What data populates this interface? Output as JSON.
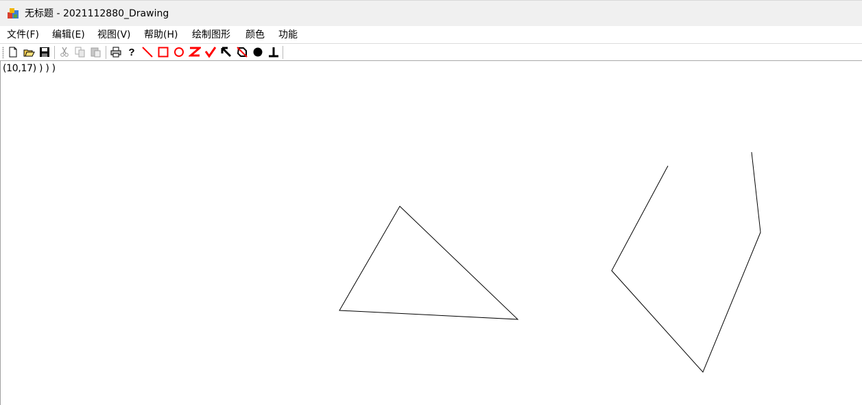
{
  "window": {
    "title": "无标题 - 2021112880_Drawing",
    "app_icon": "mfc-app-icon"
  },
  "menubar": {
    "items": [
      {
        "label": "文件(F)"
      },
      {
        "label": "编辑(E)"
      },
      {
        "label": "视图(V)"
      },
      {
        "label": "帮助(H)"
      },
      {
        "label": "绘制图形"
      },
      {
        "label": "颜色"
      },
      {
        "label": "功能"
      }
    ]
  },
  "toolbar": {
    "buttons": [
      {
        "icon": "new-file-icon",
        "enabled": true
      },
      {
        "icon": "open-folder-icon",
        "enabled": true
      },
      {
        "icon": "save-icon",
        "enabled": true
      },
      {
        "icon": "cut-icon",
        "enabled": false
      },
      {
        "icon": "copy-icon",
        "enabled": false
      },
      {
        "icon": "paste-icon",
        "enabled": false
      },
      {
        "icon": "print-icon",
        "enabled": true
      },
      {
        "icon": "help-icon",
        "enabled": true
      },
      {
        "icon": "line-tool-icon",
        "enabled": true
      },
      {
        "icon": "rectangle-tool-icon",
        "enabled": true
      },
      {
        "icon": "circle-tool-icon",
        "enabled": true
      },
      {
        "icon": "z-shape-tool-icon",
        "enabled": true
      },
      {
        "icon": "check-shape-tool-icon",
        "enabled": true
      },
      {
        "icon": "arrow-tool-icon",
        "enabled": true
      },
      {
        "icon": "crossed-shape-tool-icon",
        "enabled": true
      },
      {
        "icon": "filled-dot-tool-icon",
        "enabled": true
      },
      {
        "icon": "perpendicular-tool-icon",
        "enabled": true
      }
    ],
    "accent_color": "#ff0000"
  },
  "canvas": {
    "cursor_readout": "(10,17) ) ) )",
    "stroke_color": "#000000"
  }
}
